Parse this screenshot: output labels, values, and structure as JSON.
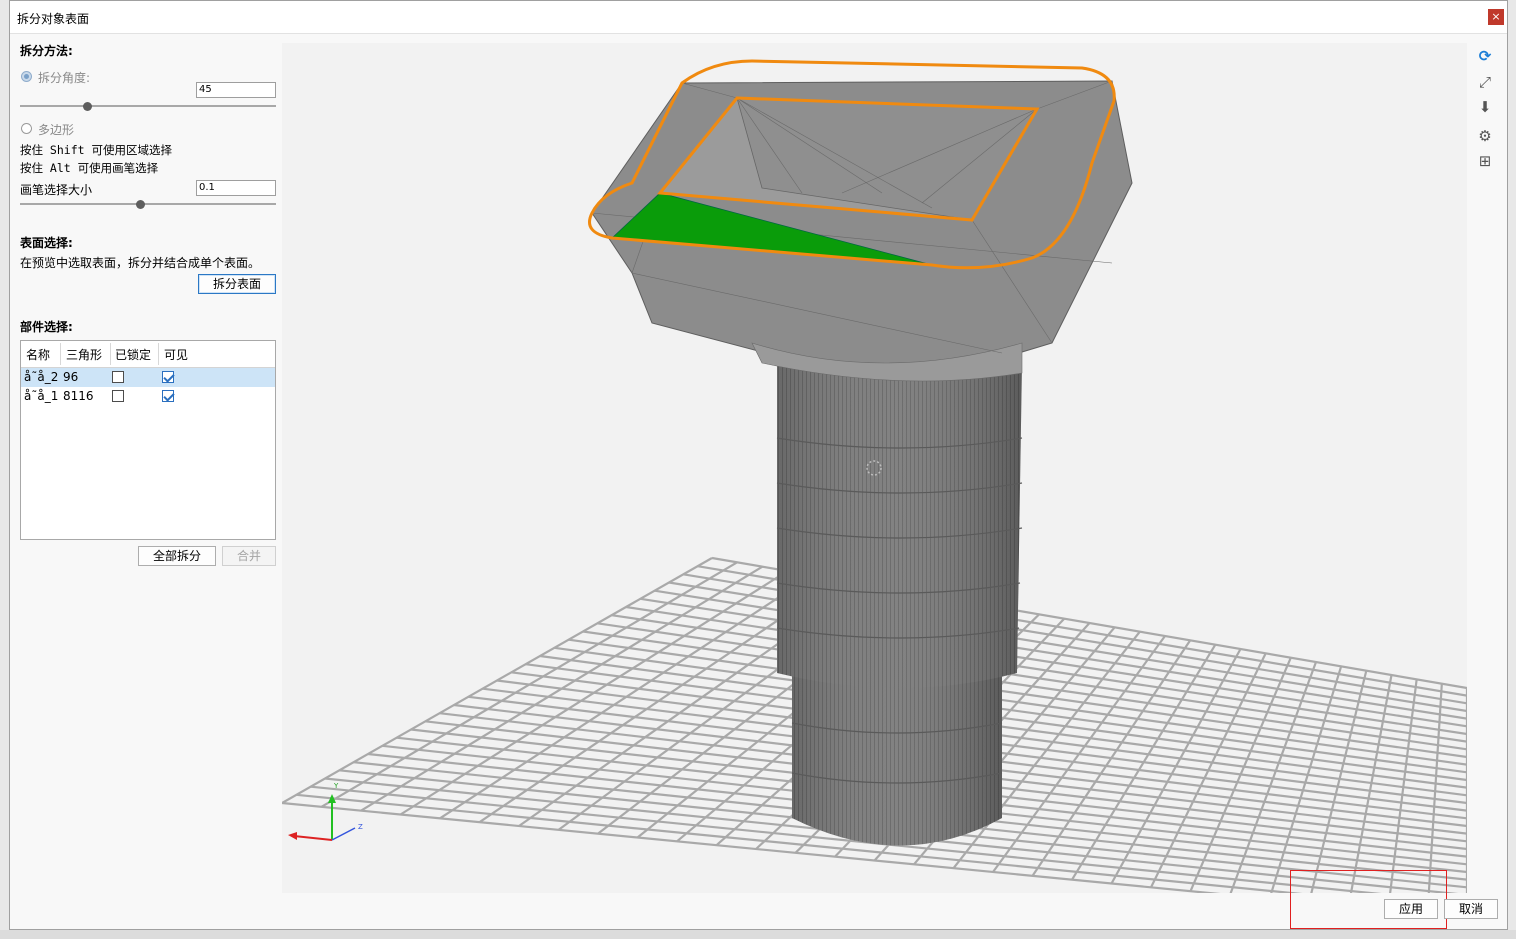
{
  "window": {
    "title": "拆分对象表面",
    "close_glyph": "×"
  },
  "split_method": {
    "title": "拆分方法:",
    "angle_option": "拆分角度:",
    "angle_value": "45",
    "polygon_option": "多边形",
    "hint_shift": "按住 Shift 可使用区域选择",
    "hint_alt": "按住 Alt 可使用画笔选择",
    "brush_size_label": "画笔选择大小",
    "brush_size_value": "0.1"
  },
  "surface_select": {
    "title": "表面选择:",
    "hint": "在预览中选取表面，拆分并结合成单个表面。",
    "split_surface_button": "拆分表面"
  },
  "parts": {
    "title": "部件选择:",
    "columns": [
      "名称",
      "三角形",
      "已锁定",
      "可见"
    ],
    "rows": [
      {
        "name": "å˜å_2",
        "triangles": "96",
        "locked": false,
        "visible": true,
        "selected": true
      },
      {
        "name": "å˜å_1",
        "triangles": "8116",
        "locked": false,
        "visible": true,
        "selected": false
      }
    ],
    "split_all_button": "全部拆分",
    "merge_button": "合并"
  },
  "viewport_tools": [
    {
      "icon": "refresh-icon"
    },
    {
      "icon": "fit-view-icon"
    },
    {
      "icon": "drop-to-floor-icon"
    },
    {
      "icon": "settings-gear-icon"
    },
    {
      "icon": "grid-toggle-icon"
    }
  ],
  "axis_labels": {
    "y": "Y",
    "z": "Z"
  },
  "footer": {
    "apply_button": "应用",
    "cancel_button": "取消"
  },
  "colors": {
    "selected_edge": "#f08a10",
    "selected_face": "#0a9c0a",
    "model_gray": "#8c8c8c",
    "grid": "#aaaaaa",
    "accent_blue": "#1c7ed6",
    "highlight_red": "#e02020"
  }
}
